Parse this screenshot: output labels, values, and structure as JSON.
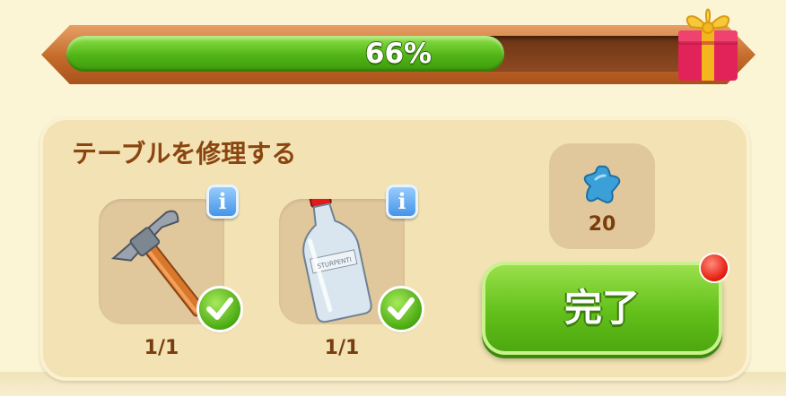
{
  "progress": {
    "percent": 66,
    "label": "66%"
  },
  "gift": {
    "icon": "gift-box-icon"
  },
  "task": {
    "title": "テーブルを修理する"
  },
  "requirements": [
    {
      "name": "hammer",
      "icon": "hammer-icon",
      "count": "1/1",
      "info": "i",
      "complete": true
    },
    {
      "name": "turpentine",
      "icon": "bottle-icon",
      "bottle_text": "STURPENTI",
      "count": "1/1",
      "info": "i",
      "complete": true
    }
  ],
  "reward": {
    "icon": "blue-star-icon",
    "value": "20"
  },
  "done_button": {
    "label": "完了",
    "badge": "red-notification-dot"
  },
  "colors": {
    "progress_fill": "#52b416",
    "frame": "#c46a2a",
    "title_text": "#8a4510",
    "button_green": "#62c01a",
    "info_blue": "#3d8fe6"
  }
}
